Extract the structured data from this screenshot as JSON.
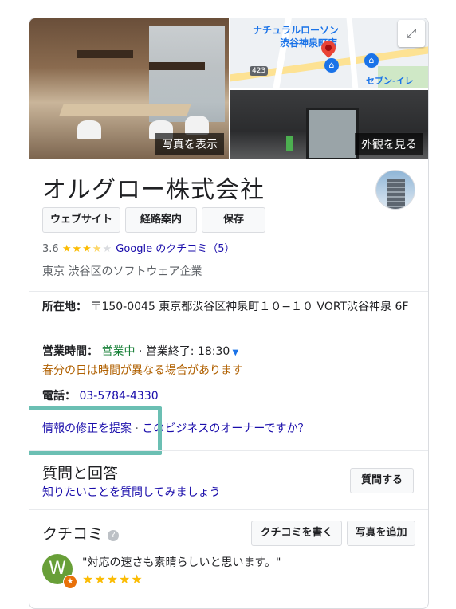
{
  "photos": {
    "main_label": "写真を表示",
    "exterior_label": "外観を見る"
  },
  "map": {
    "place_line1": "ナチュラルローソン",
    "place_line2": "渋谷神泉町店",
    "route_number": "423",
    "bottom_text": "セブン-イレ"
  },
  "business": {
    "name": "オルグロー株式会社",
    "rating": "3.6",
    "stars_filled": "★★★",
    "stars_half": "★",
    "stars_empty": "★",
    "reviews_link": "Google のクチコミ（5）",
    "category": "東京 渋谷区のソフトウェア企業"
  },
  "actions": {
    "website": "ウェブサイト",
    "directions": "経路案内",
    "save": "保存"
  },
  "info": {
    "address_label": "所在地：",
    "address_value": "〒150-0045 東京都渋谷区神泉町１０−１０ VORT渋谷神泉 6F",
    "hours_label": "営業時間：",
    "hours_open": "営業中",
    "hours_sep": " · ",
    "hours_close": "営業終了: 18:30",
    "hours_note": "春分の日は時間が異なる場合があります",
    "phone_label": "電話：",
    "phone_value": "03-5784-4330",
    "suggest_edit": "情報の修正を提案",
    "link_sep": " · ",
    "owner_link": "このビジネスのオーナーですか？"
  },
  "qa": {
    "heading": "質問と回答",
    "prompt": "知りたいことを質問してみましょう",
    "ask_button": "質問する"
  },
  "reviews": {
    "heading": "クチコミ",
    "write_button": "クチコミを書く",
    "add_photo_button": "写真を追加",
    "first_review_avatar_letter": "W",
    "first_review_text": "\"対応の速さも素晴らしいと思います。\"",
    "first_review_stars": "★★★★★"
  },
  "colors": {
    "link": "#1a0dab",
    "open_green": "#188038",
    "note_orange": "#b06000",
    "highlight_teal": "#6bbfb3"
  }
}
